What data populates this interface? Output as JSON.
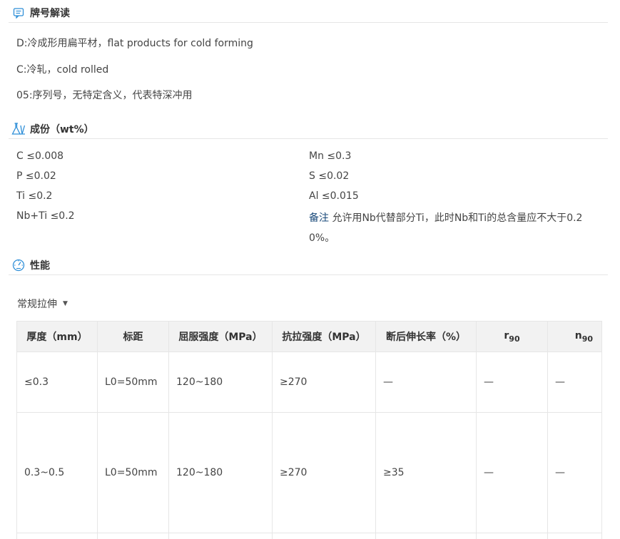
{
  "sections": {
    "designation": {
      "title": "牌号解读",
      "lines": [
        "D:冷成形用扁平材，flat products for cold forming",
        "C:冷轧，cold rolled",
        "05:序列号，无特定含义，代表特深冲用"
      ]
    },
    "composition": {
      "title": "成份（wt%）",
      "left": [
        {
          "el": "C",
          "val": "≤0.008"
        },
        {
          "el": "P",
          "val": "≤0.02"
        },
        {
          "el": "Ti",
          "val": "≤0.2"
        },
        {
          "el": "Nb+Ti",
          "val": "≤0.2"
        }
      ],
      "right": [
        {
          "el": "Mn",
          "val": "≤0.3"
        },
        {
          "el": "S",
          "val": "≤0.02"
        },
        {
          "el": "Al",
          "val": "≤0.015"
        }
      ],
      "note_label": "备注",
      "note_text": "允许用Nb代替部分Ti，此时Nb和Ti的总含量应不大于0.20%。"
    },
    "performance": {
      "title": "性能",
      "dropdown_label": "常规拉伸",
      "table": {
        "headers": [
          "厚度（mm）",
          "标距",
          "屈服强度（MPa）",
          "抗拉强度（MPa）",
          "断后伸长率（%）",
          "r",
          "n"
        ],
        "header_subs": {
          "r": "90",
          "n": "90"
        },
        "rows": [
          [
            "≤0.3",
            "L0=50mm",
            "120~180",
            "≥270",
            "—",
            "—",
            "—"
          ],
          [
            "0.3~0.5",
            "L0=50mm",
            "120~180",
            "≥270",
            "≥35",
            "—",
            "—"
          ]
        ]
      }
    }
  },
  "colors": {
    "icon_blue": "#2f8fd8",
    "header_bg": "#f2f2f2",
    "border": "#e6e6e6",
    "note_label": "#1a4a7a"
  }
}
